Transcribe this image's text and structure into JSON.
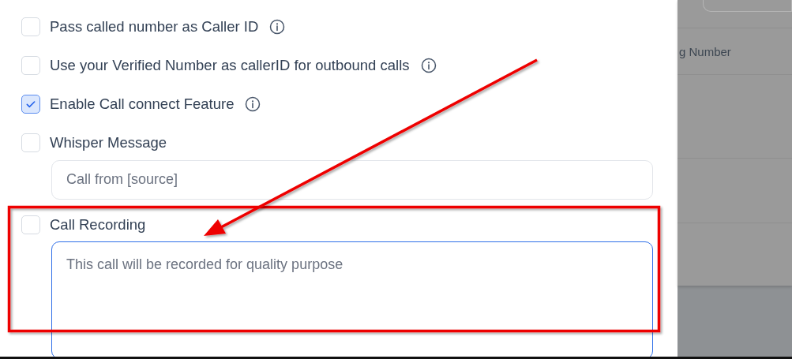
{
  "options": [
    {
      "kind": "checkbox",
      "label": "Pass called number as Caller ID",
      "checked": false,
      "info": true
    },
    {
      "kind": "checkbox",
      "label": "Use your Verified Number as callerID for outbound calls",
      "checked": false,
      "info": true
    },
    {
      "kind": "checkbox",
      "label": "Enable Call connect Feature",
      "checked": true,
      "info": true
    },
    {
      "kind": "checkbox_field",
      "label": "Whisper Message",
      "checked": false,
      "info": false,
      "field": {
        "placeholder": "Call from [source]",
        "focused": false,
        "multiline": false
      }
    },
    {
      "kind": "checkbox_field",
      "label": "Call Recording",
      "checked": false,
      "info": false,
      "field": {
        "placeholder": "This call will be recorded for quality purpose",
        "focused": true,
        "multiline": true
      }
    }
  ],
  "background_table": {
    "header": "g Number"
  }
}
